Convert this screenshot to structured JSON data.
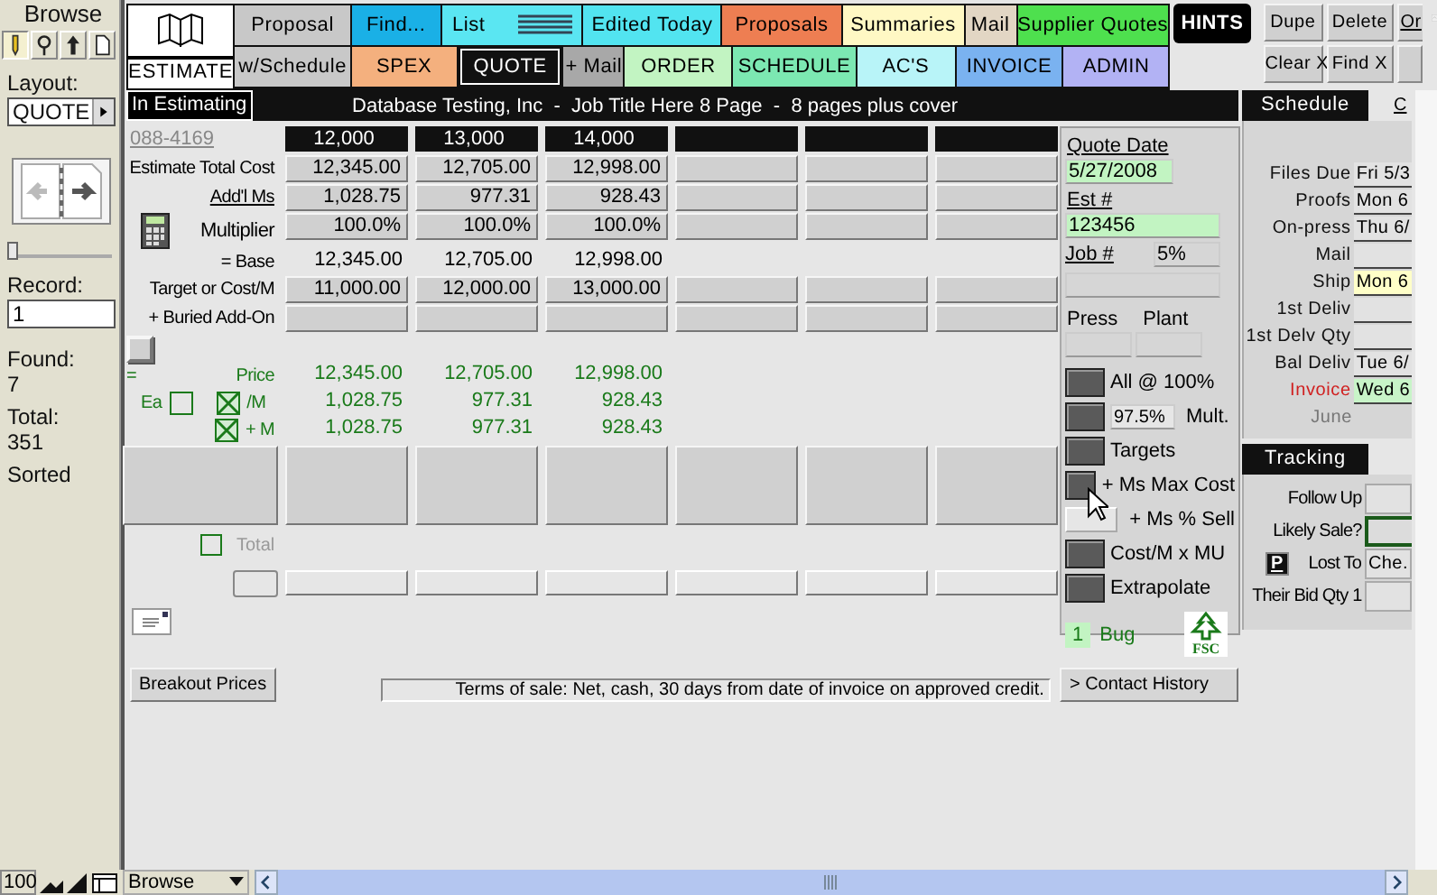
{
  "sidebar": {
    "mode": "Browse",
    "tools": [
      {
        "kind": "browse",
        "selected": true
      },
      {
        "kind": "find",
        "selected": false
      },
      {
        "kind": "layout",
        "selected": false
      },
      {
        "kind": "preview",
        "selected": false
      }
    ],
    "layout_label": "Layout:",
    "layout": "QUOTE",
    "record_slider": {
      "level": 0
    },
    "record_label": "Record:",
    "record": "1",
    "found_label": "Found:",
    "found": "7",
    "total_label": "Total:",
    "total": "351",
    "sort_state": "Sorted"
  },
  "nav": {
    "logo_label": "ESTIMATE",
    "row1": [
      {
        "label": "Proposal",
        "color": "#c8c8c8"
      },
      {
        "label": "Find...",
        "color": "#1ab0e6"
      },
      {
        "label": "List",
        "color": "#5ae6f2"
      },
      {
        "label": "Edited Today",
        "color": "#52e4f0"
      },
      {
        "label": "Proposals",
        "color": "#ee7e52"
      },
      {
        "label": "Summaries",
        "color": "#fff8c4"
      },
      {
        "label": "Mail",
        "color": "#e2d6c4"
      },
      {
        "label": "Supplier Quotes",
        "color": "#4ee04e"
      }
    ],
    "hints": "HINTS",
    "row2": [
      {
        "label": "w/Schedule",
        "color": "#c8c8c8",
        "selected": false
      },
      {
        "label": "SPEX",
        "color": "#f4b07e",
        "selected": false
      },
      {
        "label": "QUOTE",
        "color": "#111111",
        "selected": true
      },
      {
        "label": "+ Mail",
        "color": "#a8a8a8",
        "selected": false
      },
      {
        "label": "ORDER",
        "color": "#c2f4c2",
        "selected": false
      },
      {
        "label": "SCHEDULE",
        "color": "#7ce8b2",
        "selected": false
      },
      {
        "label": "AC'S",
        "color": "#b8f4f8",
        "selected": false
      },
      {
        "label": "INVOICE",
        "color": "#7ab2f0",
        "selected": false
      },
      {
        "label": "ADMIN",
        "color": "#b2b2f4",
        "selected": false
      }
    ],
    "actions": [
      "Dupe",
      "Delete",
      "Or",
      "Clear X",
      "Find X"
    ]
  },
  "title_bar": {
    "status": "In Estimating",
    "job_line": "Database Testing, Inc  -  Job Title Here 8 Page  -  8 pages plus cover"
  },
  "quote": {
    "job_number": "088-4169",
    "quantities": [
      "12,000",
      "13,000",
      "14,000"
    ],
    "rows": [
      {
        "label": "Estimate Total Cost",
        "kind": "field",
        "values": [
          "12,345.00",
          "12,705.00",
          "12,998.00"
        ]
      },
      {
        "label": "Add'l Ms",
        "kind": "link",
        "values": [
          "1,028.75",
          "977.31",
          "928.43"
        ]
      },
      {
        "label": "Multiplier",
        "kind": "calc",
        "values": [
          "100.0%",
          "100.0%",
          "100.0%"
        ]
      },
      {
        "label": "= Base",
        "kind": "plain",
        "values": [
          "12,345.00",
          "12,705.00",
          "12,998.00"
        ]
      },
      {
        "label": "Target or Cost/M",
        "kind": "field",
        "values": [
          "11,000.00",
          "12,000.00",
          "13,000.00"
        ]
      },
      {
        "label": "+ Buried Add-On",
        "kind": "field",
        "values": []
      }
    ],
    "addon_checked": false,
    "equals": "=",
    "each_label": "Ea",
    "each_checked": false,
    "price_rows": [
      {
        "label": "Price",
        "kind": "plain",
        "values": [
          "12,345.00",
          "12,705.00",
          "12,998.00"
        ]
      },
      {
        "label": "/M",
        "kind": "check",
        "checked": true,
        "values": [
          "1,028.75",
          "977.31",
          "928.43"
        ]
      },
      {
        "label": "+ M",
        "kind": "check",
        "checked": true,
        "values": [
          "1,028.75",
          "977.31",
          "928.43"
        ]
      }
    ],
    "total": {
      "label": "Total",
      "checked": false
    },
    "breakout_button": "Breakout Prices",
    "terms": "Terms of sale: Net, cash, 30 days from date of invoice on approved credit."
  },
  "quote_panel": {
    "quote_date_label": "Quote Date",
    "quote_date": "5/27/2008",
    "est_label": "Est #",
    "est": "123456",
    "job_label": "Job #",
    "job_pct": "5%",
    "press_label": "Press",
    "plant_label": "Plant",
    "actions": [
      {
        "label": "All @ 100%",
        "disabled": false
      },
      {
        "label": "Mult.",
        "value": "97.5%",
        "disabled": false
      },
      {
        "label": "Targets",
        "disabled": false
      },
      {
        "label": "+ Ms Max Cost",
        "disabled": false
      },
      {
        "label": "+ Ms % Sell",
        "disabled": true
      },
      {
        "label": "Cost/M x MU",
        "disabled": false
      },
      {
        "label": "Extrapolate",
        "disabled": false
      }
    ],
    "bug_count": "1",
    "bug_label": "Bug",
    "logo_text": "FSC",
    "contact_history": "> Contact History"
  },
  "schedule": {
    "title": "Schedule",
    "tab2": "C",
    "rows": [
      {
        "label": "Files Due",
        "value": "Fri 5/3",
        "kind": "normal",
        "color": "#e2e2e2"
      },
      {
        "label": "Proofs",
        "value": "Mon 6",
        "kind": "normal",
        "color": "#e2e2e2"
      },
      {
        "label": "On-press",
        "value": "Thu 6/",
        "kind": "normal",
        "color": "#e2e2e2"
      },
      {
        "label": "Mail",
        "kind": "normal",
        "color": "#e2e2e2"
      },
      {
        "label": "Ship",
        "value": "Mon 6",
        "kind": "normal",
        "color": "#ffffc8"
      },
      {
        "label": "1st Deliv",
        "kind": "normal",
        "color": "#e2e2e2"
      },
      {
        "label": "1st Delv Qty",
        "kind": "normal",
        "color": "#e2e2e2"
      },
      {
        "label": "Bal Deliv",
        "value": "Tue 6/",
        "kind": "normal",
        "color": "#e2e2e2"
      },
      {
        "label": "Invoice",
        "value": "Wed 6",
        "kind": "alert",
        "color": "#c8f4c8"
      }
    ],
    "month": "June"
  },
  "tracking": {
    "title": "Tracking",
    "rows": [
      {
        "label": "Follow Up",
        "kind": "field"
      },
      {
        "label": "Likely Sale?",
        "kind": "highlight"
      },
      {
        "label": "Lost To",
        "value": "Che.",
        "kind": "lost",
        "button": "P"
      },
      {
        "label": "Their Bid Qty 1",
        "kind": "field"
      }
    ]
  },
  "status_bar": {
    "zoom": "100",
    "mode": "Browse"
  }
}
